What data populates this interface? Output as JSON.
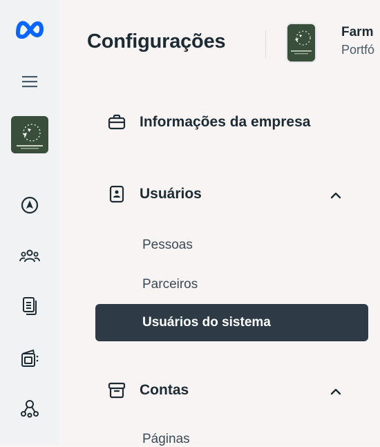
{
  "rail": {
    "items": [
      {
        "icon": "meta-logo-icon"
      },
      {
        "icon": "menu-icon"
      },
      {
        "icon": "business-avatar"
      },
      {
        "icon": "navigation-icon"
      },
      {
        "icon": "people-group-icon"
      },
      {
        "icon": "document-stack-icon"
      },
      {
        "icon": "storefront-icon"
      },
      {
        "icon": "integrations-icon"
      }
    ]
  },
  "header": {
    "title": "Configurações",
    "business_name": "Farm",
    "business_sub": "Portfó"
  },
  "nav": {
    "business_info": "Informações da empresa",
    "users": {
      "label": "Usuários",
      "items": [
        "Pessoas",
        "Parceiros",
        "Usuários do sistema"
      ]
    },
    "accounts": {
      "label": "Contas",
      "items": [
        "Páginas"
      ]
    }
  },
  "colors": {
    "active_bg": "#2e3b46",
    "meta_blue": "#0866ff",
    "text": "#1c2b33"
  }
}
